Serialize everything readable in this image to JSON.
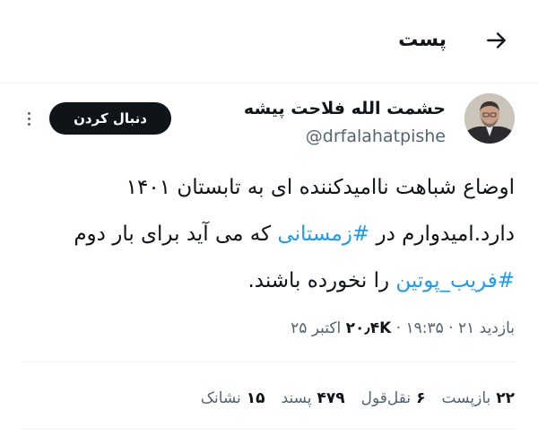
{
  "header": {
    "title": "پست",
    "back_icon": "arrow-right-icon"
  },
  "tweet": {
    "author_name": "حشمت الله فلاحت پیشه",
    "author_handle": "@drfalahatpishe",
    "follow_label": "دنبال کردن",
    "text_line1": "اوضاع شباهت ناامیدکننده ای به تابستان ۱۴۰۱",
    "text_line2_a": "دارد.امیدوارم در ",
    "hashtag1": "#زمستانی",
    "text_line2_b": " که می آید برای بار دوم",
    "hashtag2": "#فریب_پوتین",
    "text_line3_b": " را نخورده باشند.",
    "meta_prefix": "بازدید",
    "views_count": "۲۰٫۴K",
    "meta_rest": " · ۱۹:۳۵ · ۲۱ اکتبر ۲۵"
  },
  "stats": [
    {
      "num": "۲۲",
      "label": "بازپست"
    },
    {
      "num": "۶",
      "label": "نقل‌قول"
    },
    {
      "num": "۴۷۹",
      "label": "پسند"
    },
    {
      "num": "۱۵",
      "label": "نشانک"
    }
  ],
  "colors": {
    "hashtag": "#1d9bf0",
    "button_bg": "#0f1419",
    "secondary_text": "#536471"
  }
}
